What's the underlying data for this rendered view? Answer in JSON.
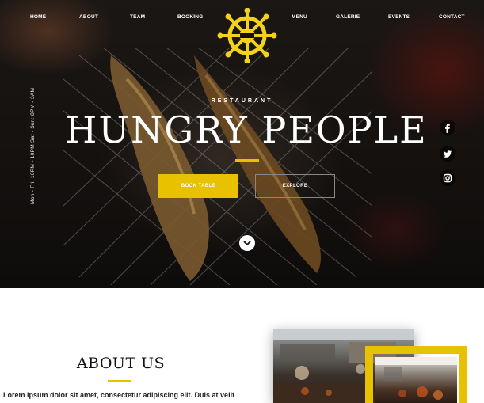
{
  "nav": {
    "home": "HOME",
    "about": "ABOUT",
    "team": "TEAM",
    "booking": "BOOKING",
    "menu": "MENU",
    "galerie": "GALERIE",
    "events": "EVENTS",
    "contact": "CONTACT"
  },
  "hero": {
    "eyebrow": "RESTAURANT",
    "title": "HUNGRY PEOPLE",
    "hours": "Mon - Fri: 10PM - 10PM Sat - Sun: 8PM - 3AM",
    "book_button": "BOOK TABLE",
    "explore_button": "EXPLORE"
  },
  "social": [
    "facebook-icon",
    "twitter-icon",
    "instagram-icon"
  ],
  "about": {
    "title": "ABOUT US",
    "text": "Lorem ipsum dolor sit amet, consectetur adipiscing elit. Duis at velit"
  },
  "colors": {
    "accent": "#e8c200",
    "hero_bg": "#15110f",
    "text": "#222222"
  }
}
